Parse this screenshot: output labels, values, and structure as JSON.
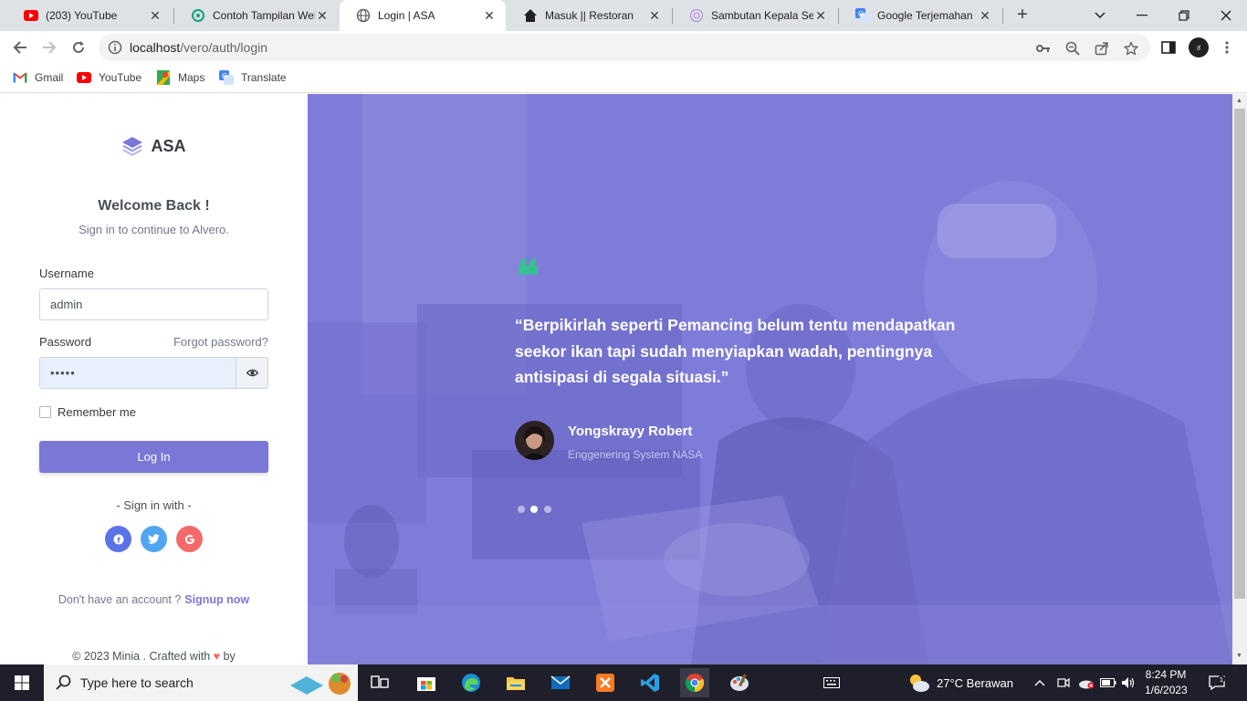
{
  "browser": {
    "tabs": [
      {
        "title": "(203) YouTube",
        "icon": "youtube-icon",
        "active": false
      },
      {
        "title": "Contoh Tampilan Web",
        "icon": "chatgpt-icon",
        "active": false
      },
      {
        "title": "Login | ASA",
        "icon": "globe-icon",
        "active": true
      },
      {
        "title": "Masuk || Restoran",
        "icon": "home-icon",
        "active": false
      },
      {
        "title": "Sambutan Kepala Seko",
        "icon": "school-icon",
        "active": false
      },
      {
        "title": "Google Terjemahan",
        "icon": "google-translate-icon",
        "active": false
      }
    ],
    "url_host": "localhost",
    "url_path": "/vero/auth/login",
    "profile_initial": "ಕ",
    "bookmarks": [
      {
        "label": "Gmail",
        "icon": "gmail-icon"
      },
      {
        "label": "YouTube",
        "icon": "youtube-icon"
      },
      {
        "label": "Maps",
        "icon": "maps-icon"
      },
      {
        "label": "Translate",
        "icon": "google-translate-icon"
      }
    ]
  },
  "login": {
    "brand": "ASA",
    "welcome": "Welcome Back !",
    "subtitle": "Sign in to continue to Alvero.",
    "username_label": "Username",
    "username_value": "admin",
    "password_label": "Password",
    "forgot_label": "Forgot password?",
    "password_value": "•••••",
    "remember_label": "Remember me",
    "login_button": "Log In",
    "sign_in_with": "- Sign in with -",
    "no_account": "Don't have an account ?",
    "signup_link": "Signup now",
    "footer_prefix": "© 2023 Minia . Crafted with",
    "footer_heart": "♥",
    "footer_suffix": "by"
  },
  "testimonial": {
    "quote_mark": "❝",
    "quote": "“Berpikirlah seperti Pemancing belum tentu mendapatkan seekor ikan tapi sudah menyiapkan wadah, pentingnya antisipasi di segala situasi.”",
    "author": "Yongskrayy Robert",
    "role": "Enggenering System NASA",
    "slides_total": 3,
    "slide_active": 2
  },
  "colors": {
    "primary": "#7b77d7",
    "accent_green": "#34c38f",
    "facebook": "#5b73e8",
    "twitter": "#50a5f1",
    "google": "#f46a6a",
    "overlay": "#7f7cd9"
  },
  "taskbar": {
    "search_placeholder": "Type here to search",
    "weather": "27°C  Berawan",
    "time": "8:24 PM",
    "date": "1/6/2023"
  }
}
